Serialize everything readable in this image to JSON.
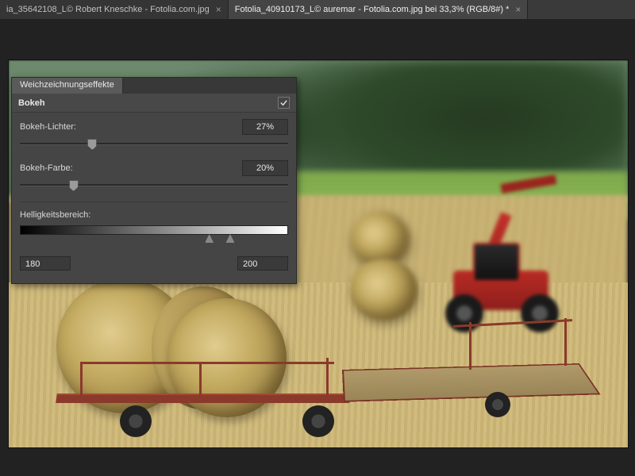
{
  "tabs": [
    {
      "label": "ia_35642108_L© Robert Kneschke - Fotolia.com.jpg",
      "active": false
    },
    {
      "label": "Fotolia_40910173_L© auremar - Fotolia.com.jpg bei 33,3% (RGB/8#) *",
      "active": true
    }
  ],
  "panel": {
    "tab_title": "Weichzeichnungseffekte",
    "section_title": "Bokeh",
    "checked": true,
    "sliders": {
      "light": {
        "label": "Bokeh-Lichter:",
        "value": "27%",
        "pos": 27
      },
      "color": {
        "label": "Bokeh-Farbe:",
        "value": "20%",
        "pos": 20
      }
    },
    "range": {
      "label": "Helligkeitsbereich:",
      "low": "180",
      "high": "200",
      "low_pos": 70.6,
      "high_pos": 78.4
    }
  }
}
